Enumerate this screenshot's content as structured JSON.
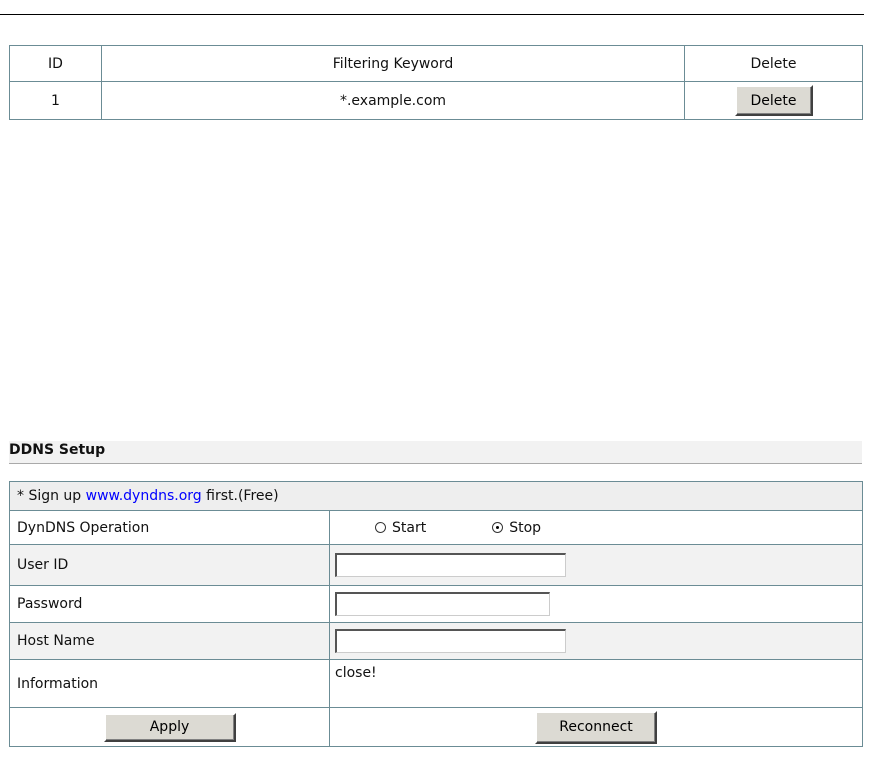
{
  "filter_table": {
    "headers": [
      "ID",
      "Filtering Keyword",
      "Delete"
    ],
    "rows": [
      {
        "id": "1",
        "keyword": "*.example.com",
        "delete_label": "Delete"
      }
    ]
  },
  "ddns": {
    "title": "DDNS Setup",
    "note": {
      "prefix": "* Sign up ",
      "link_text": "www.dyndns.org",
      "suffix": " first.(Free)"
    },
    "operation": {
      "label": "DynDNS Operation",
      "start_label": "Start",
      "stop_label": "Stop",
      "selected": "Stop"
    },
    "user_id": {
      "label": "User ID",
      "value": ""
    },
    "password": {
      "label": "Password",
      "value": ""
    },
    "host_name": {
      "label": "Host Name",
      "value": ""
    },
    "information": {
      "label": "Information",
      "value": "close!"
    },
    "apply_label": "Apply",
    "reconnect_label": "Reconnect"
  }
}
